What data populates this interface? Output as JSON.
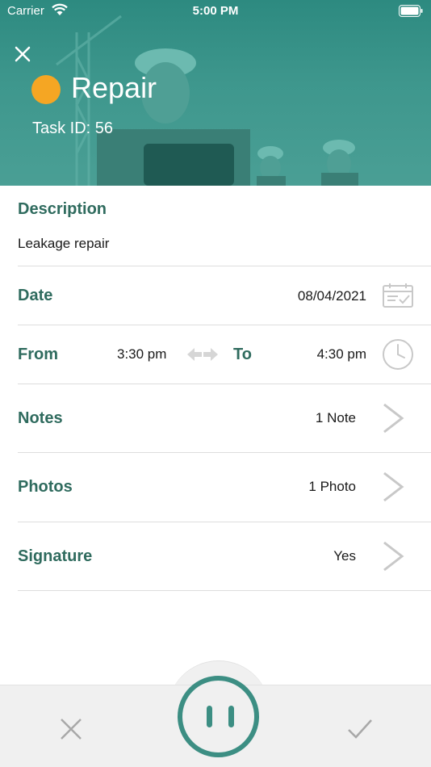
{
  "status_bar": {
    "carrier": "Carrier",
    "time": "5:00 PM"
  },
  "header": {
    "title": "Repair",
    "task_id": "Task ID: 56",
    "status_color": "#f5a623",
    "accent": "#2f6b5e"
  },
  "description": {
    "label": "Description",
    "value": "Leakage repair"
  },
  "date": {
    "label": "Date",
    "value": "08/04/2021",
    "icon": "calendar-icon"
  },
  "time": {
    "from_label": "From",
    "from_value": "3:30 pm",
    "to_label": "To",
    "to_value": "4:30 pm",
    "icon": "clock-icon"
  },
  "notes": {
    "label": "Notes",
    "value": "1 Note"
  },
  "photos": {
    "label": "Photos",
    "value": "1 Photo"
  },
  "signature": {
    "label": "Signature",
    "value": "Yes"
  },
  "bottom_bar": {
    "cancel_icon": "close-icon",
    "pause_icon": "pause-icon",
    "confirm_icon": "checkmark-icon"
  }
}
